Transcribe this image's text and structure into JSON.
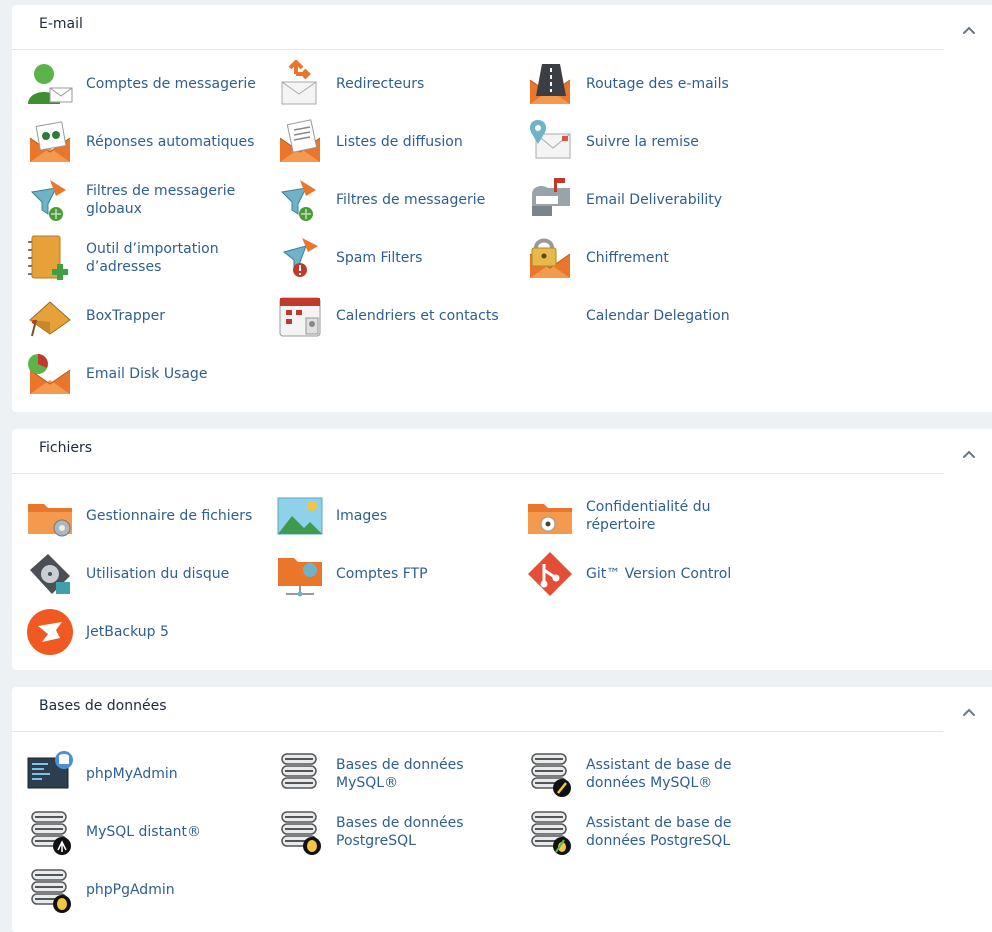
{
  "sections": {
    "email": {
      "title": "E-mail",
      "items": [
        {
          "label": "Comptes de messagerie",
          "icon": "email-accounts-icon"
        },
        {
          "label": "Redirecteurs",
          "icon": "forwarders-icon"
        },
        {
          "label": "Routage des e-mails",
          "icon": "email-routing-icon"
        },
        {
          "label": "Réponses automatiques",
          "icon": "autoresponders-icon"
        },
        {
          "label": "Listes de diffusion",
          "icon": "mailing-lists-icon"
        },
        {
          "label": "Suivre la remise",
          "icon": "track-delivery-icon"
        },
        {
          "label": "Filtres de messagerie globaux",
          "icon": "global-email-filters-icon"
        },
        {
          "label": "Filtres de messagerie",
          "icon": "email-filters-icon"
        },
        {
          "label": "Email Deliverability",
          "icon": "email-deliverability-icon"
        },
        {
          "label": "Outil d’importation d’adresses",
          "icon": "address-importer-icon"
        },
        {
          "label": "Spam Filters",
          "icon": "spam-filters-icon"
        },
        {
          "label": "Chiffrement",
          "icon": "encryption-icon"
        },
        {
          "label": "BoxTrapper",
          "icon": "boxtrapper-icon"
        },
        {
          "label": "Calendriers et contacts",
          "icon": "calendars-contacts-icon"
        },
        {
          "label": "Calendar Delegation",
          "icon": ""
        },
        {
          "label": "Email Disk Usage",
          "icon": "email-disk-usage-icon"
        }
      ]
    },
    "files": {
      "title": "Fichiers",
      "items": [
        {
          "label": "Gestionnaire de fichiers",
          "icon": "file-manager-icon"
        },
        {
          "label": "Images",
          "icon": "images-icon"
        },
        {
          "label": "Confidentialité du répertoire",
          "icon": "directory-privacy-icon"
        },
        {
          "label": "Utilisation du disque",
          "icon": "disk-usage-icon"
        },
        {
          "label": "Comptes FTP",
          "icon": "ftp-accounts-icon"
        },
        {
          "label": "Git™ Version Control",
          "icon": "git-icon"
        },
        {
          "label": "JetBackup 5",
          "icon": "jetbackup-icon"
        }
      ]
    },
    "databases": {
      "title": "Bases de données",
      "items": [
        {
          "label": "phpMyAdmin",
          "icon": "phpmyadmin-icon"
        },
        {
          "label": "Bases de données MySQL®",
          "icon": "mysql-databases-icon"
        },
        {
          "label": "Assistant de base de données MySQL®",
          "icon": "mysql-wizard-icon"
        },
        {
          "label": "MySQL distant®",
          "icon": "remote-mysql-icon"
        },
        {
          "label": "Bases de données PostgreSQL",
          "icon": "postgresql-databases-icon"
        },
        {
          "label": "Assistant de base de données PostgreSQL",
          "icon": "postgresql-wizard-icon"
        },
        {
          "label": "phpPgAdmin",
          "icon": "phppgadmin-icon"
        }
      ]
    }
  },
  "colors": {
    "label": "#2e5f8f",
    "envelope": "#e9762b",
    "background": "#eef1f4"
  }
}
